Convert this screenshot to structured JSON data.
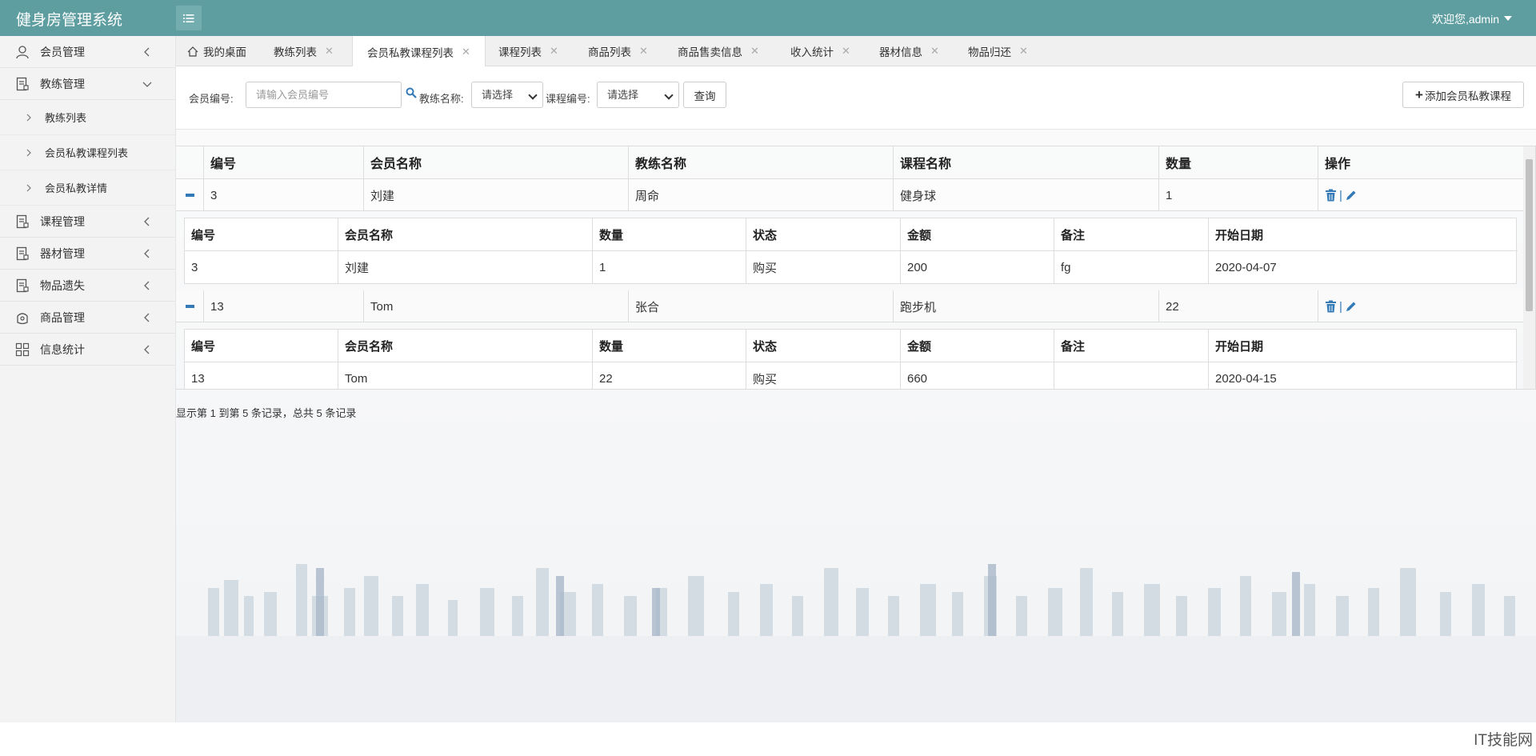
{
  "app": {
    "title": "健身房管理系统",
    "user_label": "欢迎您,admin",
    "accent": "#5f9ea0"
  },
  "sidebar": {
    "items": [
      {
        "label": "会员管理",
        "icon": "user-icon"
      },
      {
        "label": "教练管理",
        "icon": "document-icon",
        "expanded": true,
        "children": [
          "教练列表",
          "会员私教课程列表",
          "会员私教详情"
        ]
      },
      {
        "label": "课程管理",
        "icon": "document-icon"
      },
      {
        "label": "器材管理",
        "icon": "document-icon"
      },
      {
        "label": "物品遗失",
        "icon": "document-icon"
      },
      {
        "label": "商品管理",
        "icon": "bag-icon"
      },
      {
        "label": "信息统计",
        "icon": "grid-icon"
      }
    ]
  },
  "tabs": [
    {
      "label": "我的桌面",
      "closable": false
    },
    {
      "label": "教练列表",
      "closable": true
    },
    {
      "label": "会员私教课程列表",
      "closable": true,
      "active": true
    },
    {
      "label": "课程列表",
      "closable": true
    },
    {
      "label": "商品列表",
      "closable": true
    },
    {
      "label": "商品售卖信息",
      "closable": true
    },
    {
      "label": "收入统计",
      "closable": true
    },
    {
      "label": "器材信息",
      "closable": true
    },
    {
      "label": "物品归还",
      "closable": true
    }
  ],
  "filters": {
    "member_no_label": "会员编号:",
    "member_no_placeholder": "请输入会员编号",
    "coach_label": "教练名称:",
    "coach_value": "请选择",
    "course_label": "课程编号:",
    "course_value": "请选择",
    "query_label": "查询",
    "add_label": "添加会员私教课程"
  },
  "table": {
    "headers": [
      "编号",
      "会员名称",
      "教练名称",
      "课程名称",
      "数量",
      "操作"
    ],
    "rows": [
      {
        "cells": [
          "3",
          "刘建",
          "周命",
          "健身球",
          "1"
        ],
        "detail": {
          "headers": [
            "编号",
            "会员名称",
            "数量",
            "状态",
            "金额",
            "备注",
            "开始日期"
          ],
          "values": [
            "3",
            "刘建",
            "1",
            "购买",
            "200",
            "fg",
            "2020-04-07"
          ]
        }
      },
      {
        "cells": [
          "13",
          "Tom",
          "张合",
          "跑步机",
          "22"
        ],
        "detail": {
          "headers": [
            "编号",
            "会员名称",
            "数量",
            "状态",
            "金额",
            "备注",
            "开始日期"
          ],
          "values": [
            "13",
            "Tom",
            "22",
            "购买",
            "660",
            "",
            "2020-04-15"
          ]
        }
      }
    ]
  },
  "pager": {
    "summary": "显示第 1 到第 5 条记录，总共 5 条记录"
  },
  "footer": {
    "watermark": "IT技能网"
  }
}
